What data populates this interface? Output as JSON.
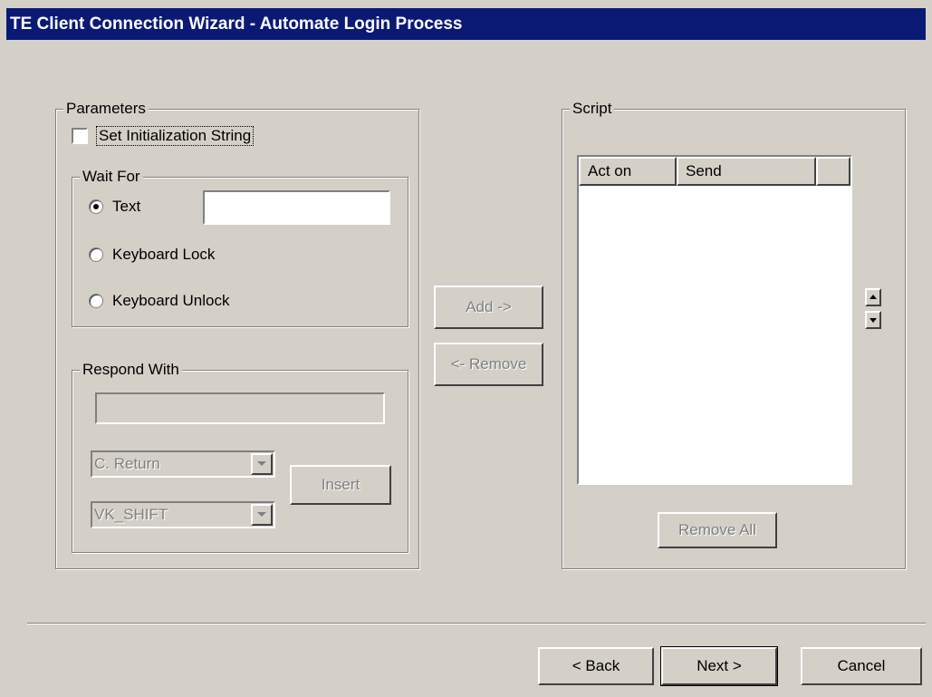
{
  "window": {
    "title": "TE Client Connection Wizard - Automate Login Process"
  },
  "parameters": {
    "legend": "Parameters",
    "set_init_label": "Set Initialization String",
    "wait_for": {
      "legend": "Wait For",
      "options": [
        "Text",
        "Keyboard Lock",
        "Keyboard Unlock"
      ],
      "selected": "Text",
      "text_value": ""
    },
    "respond_with": {
      "legend": "Respond With",
      "text_value": "",
      "combo1": "C. Return",
      "combo2": "VK_SHIFT",
      "insert_label": "Insert"
    }
  },
  "middle": {
    "add_label": "Add ->",
    "remove_label": "<- Remove"
  },
  "script": {
    "legend": "Script",
    "columns": [
      "Act on",
      "Send"
    ],
    "rows": [],
    "remove_all_label": "Remove All"
  },
  "footer": {
    "back_label": "< Back",
    "next_label": "Next >",
    "cancel_label": "Cancel"
  }
}
